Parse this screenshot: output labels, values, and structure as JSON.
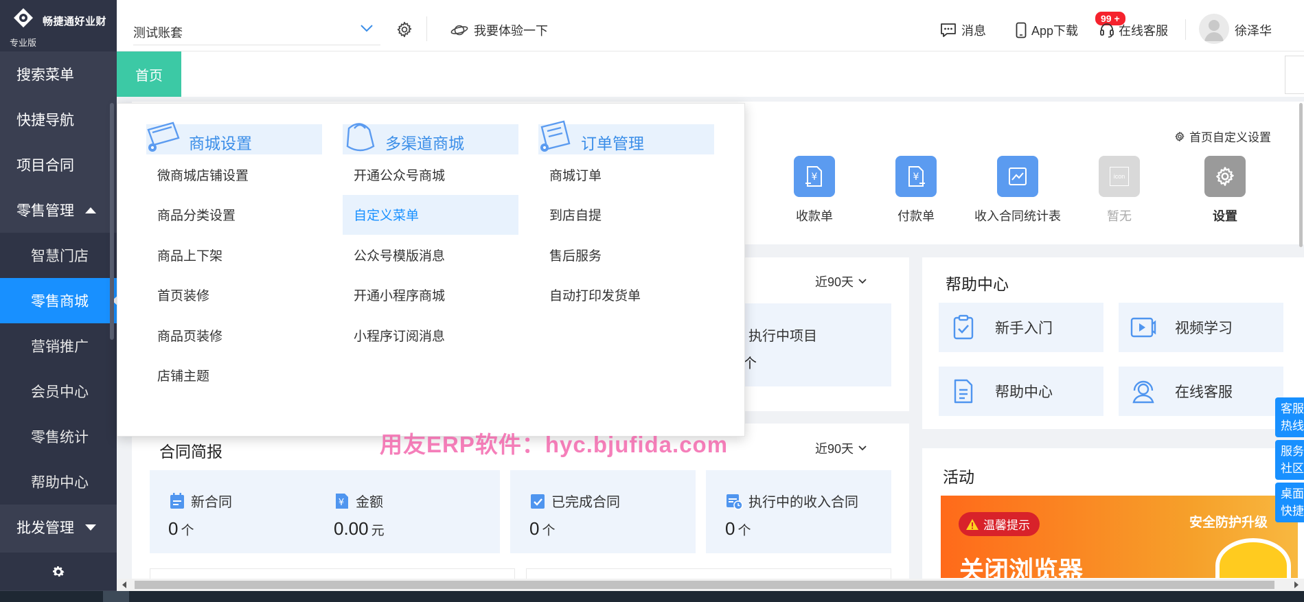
{
  "app": {
    "logo_text": "畅捷通好业财",
    "edition": "专业版"
  },
  "sidebar": {
    "items": [
      {
        "label": "搜索菜单"
      },
      {
        "label": "快捷导航"
      },
      {
        "label": "项目合同"
      },
      {
        "label": "零售管理",
        "expanded": true
      },
      {
        "label": "批发管理",
        "expanded": false
      }
    ],
    "retail_sub": [
      {
        "label": "智慧门店"
      },
      {
        "label": "零售商城",
        "active": true
      },
      {
        "label": "营销推广"
      },
      {
        "label": "会员中心"
      },
      {
        "label": "零售统计"
      },
      {
        "label": "帮助中心"
      }
    ]
  },
  "header": {
    "account": "测试账套",
    "try_label": "我要体验一下",
    "messages_label": "消息",
    "messages_badge": "99 +",
    "app_download": "App下载",
    "online_service": "在线客服",
    "user_name": "徐泽华"
  },
  "tabs": {
    "home": "首页"
  },
  "dropdown": {
    "columns": [
      {
        "title": "商城设置",
        "items": [
          "微商城店铺设置",
          "商品分类设置",
          "商品上下架",
          "首页装修",
          "商品页装修",
          "店铺主题"
        ]
      },
      {
        "title": "多渠道商城",
        "items": [
          "开通公众号商城",
          "自定义菜单",
          "公众号模版消息",
          "开通小程序商城",
          "小程序订阅消息"
        ],
        "highlighted_index": 1
      },
      {
        "title": "订单管理",
        "items": [
          "商城订单",
          "到店自提",
          "售后服务",
          "自动打印发货单"
        ]
      }
    ]
  },
  "quick_nav": {
    "custom_setting": "首页自定义设置",
    "items": [
      {
        "label": "收款单",
        "icon": "receipt-icon",
        "color": "#5b9bf0"
      },
      {
        "label": "付款单",
        "icon": "payment-icon",
        "color": "#5b9bf0"
      },
      {
        "label": "收入合同统计表",
        "icon": "chart-report-icon",
        "color": "#5b9bf0"
      },
      {
        "label": "暂无",
        "icon": "placeholder-icon",
        "color": "#d9d9d9",
        "icon_text": "icon"
      },
      {
        "label": "设置",
        "icon": "gear-icon",
        "color": "#9a9a9a"
      }
    ]
  },
  "project": {
    "period": "近90天",
    "executing_label": "执行中项目",
    "executing_unit": "个"
  },
  "contract": {
    "title": "合同简报",
    "period": "近90天",
    "stats": [
      {
        "label": "新合同",
        "value": "0",
        "unit": "个",
        "icon": "calendar-icon"
      },
      {
        "label": "金额",
        "value": "0.00",
        "unit": "元",
        "icon": "yuan-doc-icon"
      },
      {
        "label": "已完成合同",
        "value": "0",
        "unit": "个",
        "icon": "check-calendar-icon"
      },
      {
        "label": "执行中的收入合同",
        "value": "0",
        "unit": "个",
        "icon": "calendar-clock-icon"
      }
    ]
  },
  "help": {
    "title": "帮助中心",
    "items": [
      {
        "label": "新手入门",
        "icon": "clipboard-check-icon"
      },
      {
        "label": "视频学习",
        "icon": "video-icon"
      },
      {
        "label": "帮助中心",
        "icon": "document-icon"
      },
      {
        "label": "在线客服",
        "icon": "headset-person-icon"
      }
    ]
  },
  "activity": {
    "title": "活动",
    "banner_tag": "温馨提示",
    "banner_right": "安全防护升级",
    "banner_big": "关闭浏览器"
  },
  "float_tabs": [
    "客服热线",
    "服务社区",
    "桌面快捷"
  ],
  "watermark": "用友ERP软件：hyc.bjufida.com",
  "colors": {
    "sidebar_bg": "#3a3f51",
    "active_blue": "#1890ff",
    "home_tab": "#3cc9a5",
    "badge_red": "#f5222d"
  }
}
